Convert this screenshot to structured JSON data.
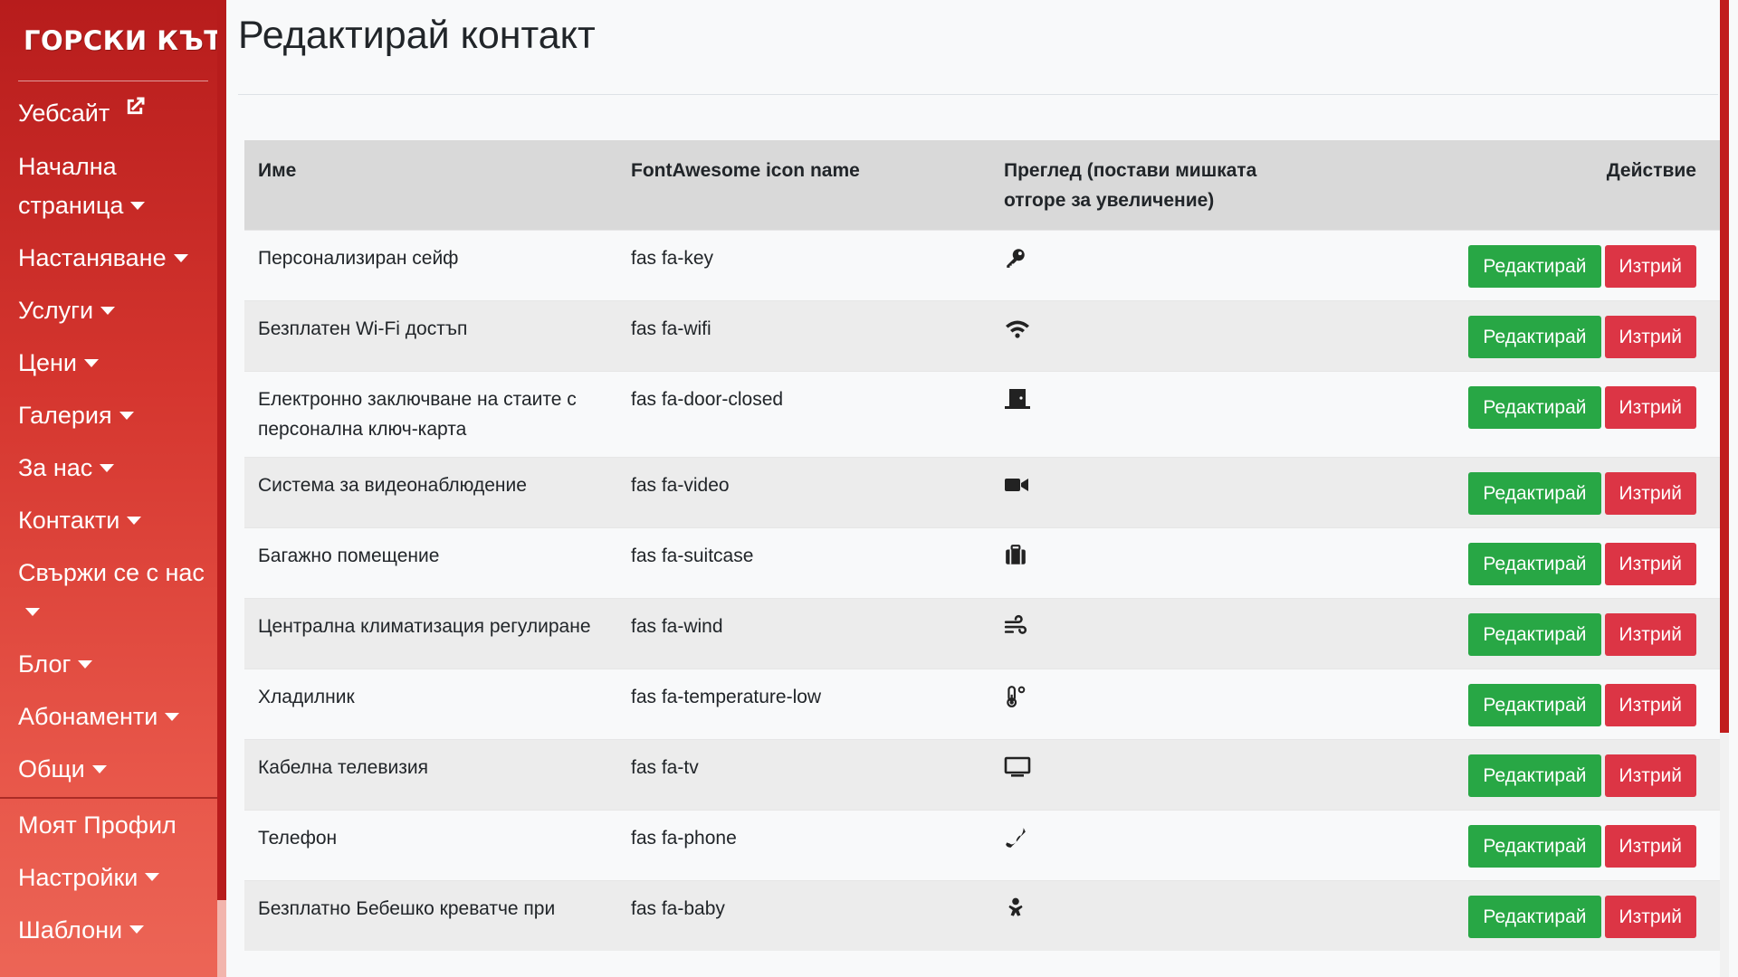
{
  "sidebar": {
    "brand": "ГОРСКИ КЪТ",
    "items": [
      {
        "label": "Уебсайт"
      },
      {
        "label": "Начална страница"
      },
      {
        "label": "Настаняване"
      },
      {
        "label": "Услуги"
      },
      {
        "label": "Цени"
      },
      {
        "label": "Галерия"
      },
      {
        "label": "За нас"
      },
      {
        "label": "Контакти"
      },
      {
        "label": "Свържи се с нас"
      },
      {
        "label": "Блог"
      },
      {
        "label": "Абонаменти"
      },
      {
        "label": "Общи"
      }
    ],
    "secondary": [
      {
        "label": "Моят Профил"
      },
      {
        "label": "Настройки"
      },
      {
        "label": "Шаблони"
      }
    ]
  },
  "page": {
    "title": "Редактирай контакт"
  },
  "table": {
    "headers": {
      "name": "Име",
      "icon_name": "FontAwesome icon name",
      "preview": "Преглед (постави мишката отгоре за увеличение)",
      "action": "Действие"
    },
    "rows": [
      {
        "name": "Персонализиран сейф",
        "icon": "fas fa-key",
        "preview_icon": "key-icon"
      },
      {
        "name": "Безплатен Wi-Fi достъп",
        "icon": "fas fa-wifi",
        "preview_icon": "wifi-icon"
      },
      {
        "name": "Електронно заключване на стаите с персонална ключ-карта",
        "icon": "fas fa-door-closed",
        "preview_icon": "door-closed-icon"
      },
      {
        "name": "Система за видеонаблюдение",
        "icon": "fas fa-video",
        "preview_icon": "video-icon"
      },
      {
        "name": "Багажно помещение",
        "icon": "fas fa-suitcase",
        "preview_icon": "suitcase-icon"
      },
      {
        "name": "Централна климатизация регулиране",
        "icon": "fas fa-wind",
        "preview_icon": "wind-icon"
      },
      {
        "name": "Хладилник",
        "icon": "fas fa-temperature-low",
        "preview_icon": "temperature-low-icon"
      },
      {
        "name": "Кабелна телевизия",
        "icon": "fas fa-tv",
        "preview_icon": "tv-icon"
      },
      {
        "name": "Телефон",
        "icon": "fas fa-phone",
        "preview_icon": "phone-icon"
      },
      {
        "name": "Безплатно Бебешко креватче при",
        "icon": "fas fa-baby",
        "preview_icon": "baby-icon"
      }
    ],
    "edit_label": "Редактирай",
    "delete_label": "Изтрий"
  },
  "colors": {
    "sidebar_top": "#b71c1c",
    "sidebar_bottom": "#ec6556",
    "edit": "#28a745",
    "delete": "#dc3545",
    "header_bg": "#d9d9d9"
  }
}
